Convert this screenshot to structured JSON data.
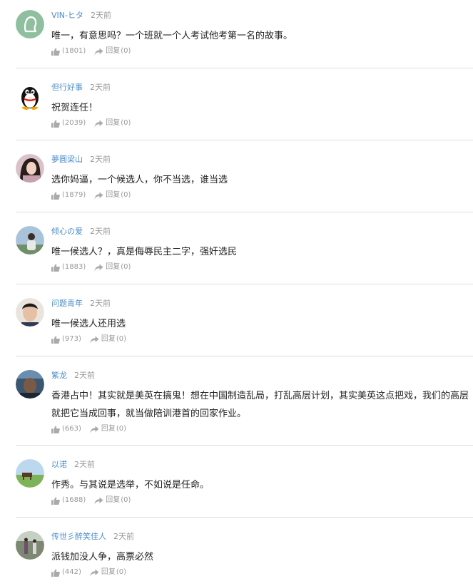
{
  "comments": [
    {
      "user": "VIN-ヒタ",
      "time": "2天前",
      "content": "唯一，有意思吗？一个班就一个人考试他考第一名的故事。",
      "likes": "(1801)",
      "reply_label": "回复",
      "reply_count": "(0)",
      "avatar": "default-avatar"
    },
    {
      "user": "但行好事",
      "time": "2天前",
      "content": "祝贺连任！",
      "likes": "(2039)",
      "reply_label": "回复",
      "reply_count": "(0)",
      "avatar": "penguin-avatar"
    },
    {
      "user": "夢圓梁山",
      "time": "2天前",
      "content": "选你妈逼，一个候选人，你不当选，谁当选",
      "likes": "(1879)",
      "reply_label": "回复",
      "reply_count": "(0)",
      "avatar": "woman-photo"
    },
    {
      "user": "倾心の爱",
      "time": "2天前",
      "content": "唯一候选人？，真是侮辱民主二字，强奸选民",
      "likes": "(1883)",
      "reply_label": "回复",
      "reply_count": "(0)",
      "avatar": "person-sky-photo"
    },
    {
      "user": "问题青年",
      "time": "2天前",
      "content": "唯一候选人还用选",
      "likes": "(973)",
      "reply_label": "回复",
      "reply_count": "(0)",
      "avatar": "face-photo"
    },
    {
      "user": "紫龙",
      "time": "2天前",
      "content": "香港占中！其实就是美英在搞鬼！想在中国制造乱局，打乱高层计划，其实美英这点把戏，我们的高层就把它当成回事，就当做陪训港首的回家作业。",
      "likes": "(663)",
      "reply_label": "回复",
      "reply_count": "(0)",
      "avatar": "dark-portrait"
    },
    {
      "user": "以诺",
      "time": "2天前",
      "content": "作秀。与其说是选举，不如说是任命。",
      "likes": "(1688)",
      "reply_label": "回复",
      "reply_count": "(0)",
      "avatar": "landscape-photo"
    },
    {
      "user": "传世彡醉笑佳人",
      "time": "2天前",
      "content": "派钱加没人争，高票必然",
      "likes": "(442)",
      "reply_label": "回复",
      "reply_count": "(0)",
      "avatar": "street-photo"
    }
  ],
  "colors": {
    "username": "#4a8cc8",
    "meta": "#999999",
    "text": "#222222",
    "divider": "#dddddd"
  },
  "icons": {
    "like": "thumbs-up-icon",
    "reply": "reply-arrow-icon"
  }
}
